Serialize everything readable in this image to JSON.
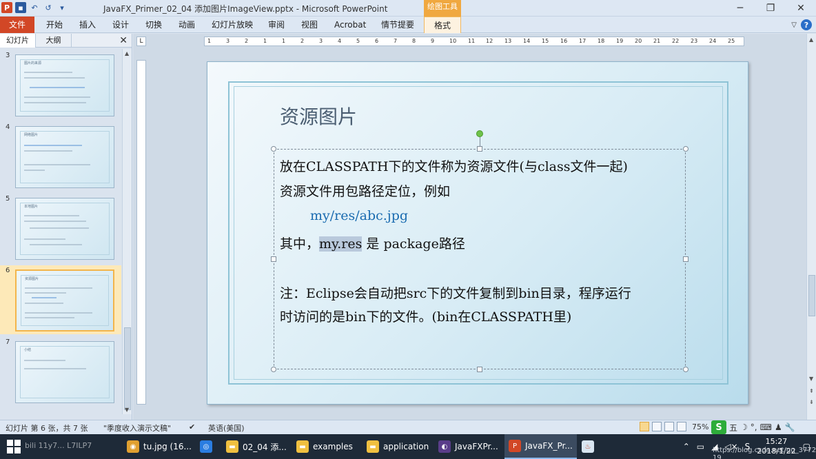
{
  "window": {
    "title": "JavaFX_Primer_02_04 添加图片ImageView.pptx - Microsoft PowerPoint",
    "context_tab_group": "绘图工具",
    "controls": [
      "─",
      "❐",
      "✕"
    ]
  },
  "qat": {
    "app_icon": "P",
    "save_icon": "▪",
    "undo_icon": "↶",
    "redo_icon": "↺",
    "more_icon": "▾"
  },
  "ribbon": {
    "file_tab": "文件",
    "tabs": [
      "开始",
      "插入",
      "设计",
      "切换",
      "动画",
      "幻灯片放映",
      "审阅",
      "视图",
      "Acrobat",
      "情节提要"
    ],
    "format_tab": "格式",
    "help_icon": "?",
    "collapse_icon": "▽"
  },
  "left_pane": {
    "tabs": [
      "幻灯片",
      "大纲"
    ],
    "close_icon": "✕",
    "thumbnails": [
      {
        "num": "3",
        "title": "图片的来源"
      },
      {
        "num": "4",
        "title": "网络图片"
      },
      {
        "num": "5",
        "title": "本地图片"
      },
      {
        "num": "6",
        "title": "资源图片"
      },
      {
        "num": "7",
        "title": "小结"
      }
    ]
  },
  "ruler": {
    "corner_icon": "L",
    "h_ticks": [
      "1",
      "3",
      "2",
      "1",
      "1",
      "2",
      "3",
      "4",
      "5",
      "6",
      "7",
      "8",
      "9",
      "10",
      "11",
      "12",
      "13",
      "14",
      "15",
      "16",
      "17",
      "18",
      "19",
      "20",
      "21",
      "22",
      "23",
      "24",
      "25"
    ]
  },
  "slide": {
    "title": "资源图片",
    "lines": [
      "放在CLASSPATH下的文件称为资源文件(与class文件一起)",
      "资源文件用包路径定位，例如",
      "my/res/abc.jpg",
      "是 package路径",
      "注：Eclipse会自动把src下的文件复制到bin目录，程序运行",
      "时访问的是bin下的文件。(bin在CLASSPATH里)"
    ],
    "line4_prefix": "其中，",
    "line4_selected": "my.res",
    "link_color": "#1a6bb0"
  },
  "status": {
    "slide_info": "幻灯片 第 6 张，共 7 张",
    "theme": "\"季度收入演示文稿\"",
    "language": "英语(美国)",
    "zoom": "75%",
    "ime": [
      "S",
      "五",
      "☽",
      "°,",
      "⌨",
      "♟",
      "🔧"
    ]
  },
  "taskbar": {
    "items": [
      {
        "label": "tu.jpg (16...",
        "icon": "◉",
        "color": "#e0a030"
      },
      {
        "label": "",
        "icon": "◎",
        "color": "#2a7de1"
      },
      {
        "label": "02_04 添...",
        "icon": "▬",
        "color": "#f0c040"
      },
      {
        "label": "examples",
        "icon": "▬",
        "color": "#f0c040"
      },
      {
        "label": "application",
        "icon": "▬",
        "color": "#f0c040"
      },
      {
        "label": "JavaFXPr...",
        "icon": "◐",
        "color": "#5a3d8a"
      },
      {
        "label": "JavaFX_Pr...",
        "icon": "P",
        "color": "#d24726"
      },
      {
        "label": "",
        "icon": "♨",
        "color": "#d9e6f2"
      }
    ],
    "clock_time": "15:27",
    "clock_date": "2018/1/22",
    "left_faded": "bili 11y7... L7ILP7",
    "watermark": "https://blog.csdn.net/qq_37723641 19"
  }
}
